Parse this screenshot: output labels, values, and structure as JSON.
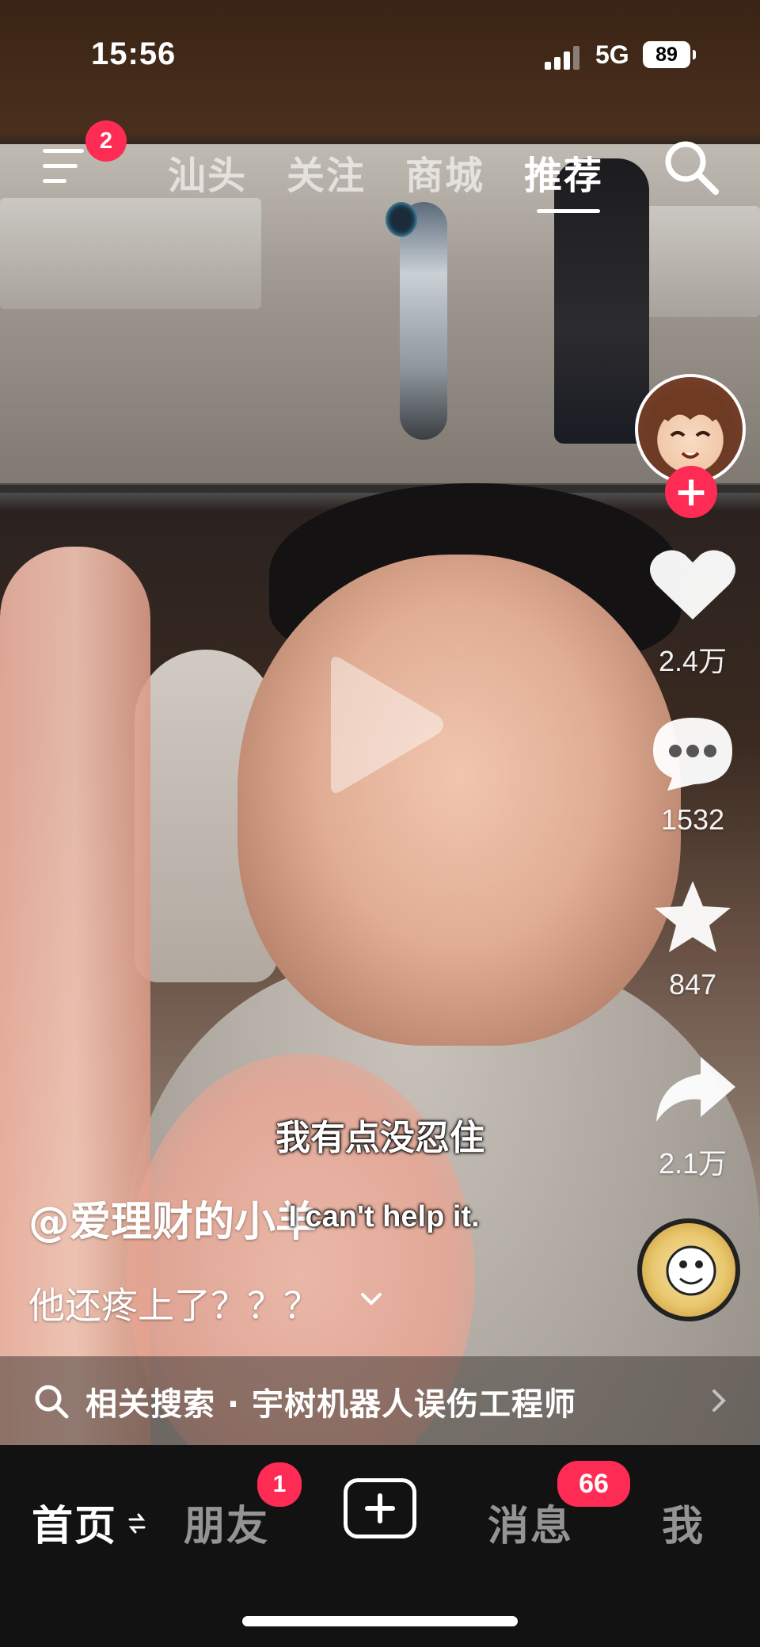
{
  "status_bar": {
    "time": "15:56",
    "network": "5G",
    "battery": "89"
  },
  "top_nav": {
    "menu_badge": "2",
    "tabs": [
      {
        "label": "汕头",
        "active": false
      },
      {
        "label": "关注",
        "active": false
      },
      {
        "label": "商城",
        "active": false
      },
      {
        "label": "推荐",
        "active": true
      }
    ]
  },
  "side_rail": {
    "likes": "2.4万",
    "comments": "1532",
    "favorites": "847",
    "shares": "2.1万",
    "follow_symbol": "+"
  },
  "video": {
    "subtitle_cn": "我有点没忍住",
    "subtitle_en": "I can't help it.",
    "author": "@爱理财的小羊",
    "description": "他还疼上了？？？"
  },
  "related_search": {
    "text": "相关搜索 · 宇树机器人误伤工程师"
  },
  "bottom_nav": {
    "home": "首页",
    "friends": "朋友",
    "friends_badge": "1",
    "messages": "消息",
    "messages_badge": "66",
    "me": "我"
  },
  "colors": {
    "accent": "#fe2c55",
    "nav_bg": "#121212"
  },
  "icons": [
    "menu-icon",
    "search-icon",
    "heart-icon",
    "comment-icon",
    "star-icon",
    "share-icon",
    "play-icon",
    "chevron-down-icon",
    "chevron-right-icon",
    "swap-icon",
    "plus-icon",
    "music-disc-icon"
  ]
}
